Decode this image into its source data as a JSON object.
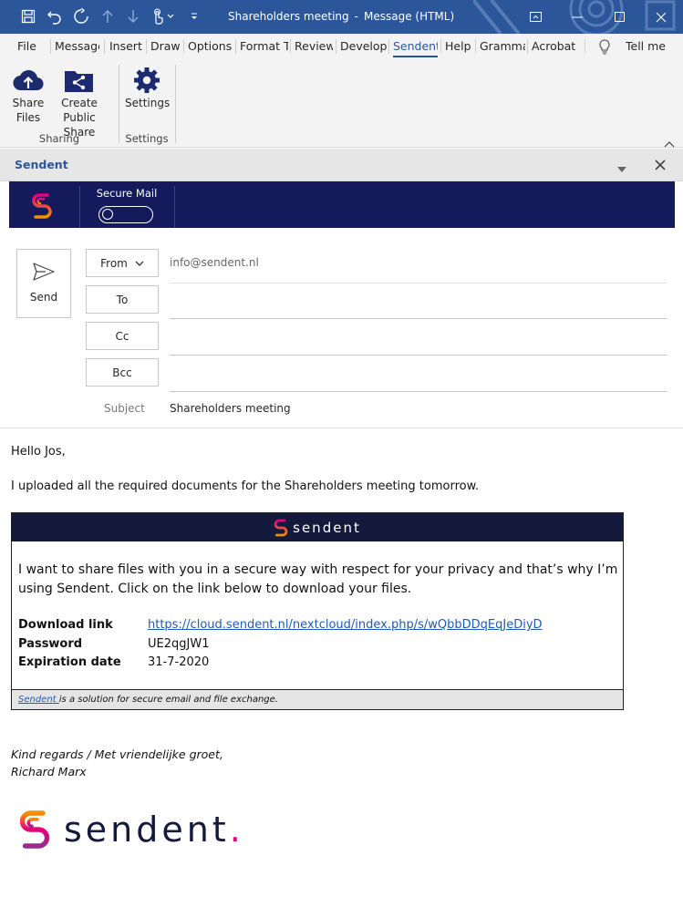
{
  "window": {
    "title": "Shareholders meeting",
    "title_sep": "-",
    "title_suffix": "Message (HTML)"
  },
  "menu": {
    "tabs": [
      "File",
      "Message",
      "Insert",
      "Draw",
      "Options",
      "Format Text",
      "Review",
      "Developer",
      "Sendent",
      "Help",
      "Grammarly",
      "Acrobat"
    ],
    "active": "Sendent",
    "tell_me": "Tell me"
  },
  "ribbon": {
    "share_files": [
      "Share",
      "Files"
    ],
    "create_public_share": [
      "Create",
      "Public Share"
    ],
    "settings": "Settings",
    "group_sharing": "Sharing",
    "group_settings": "Settings"
  },
  "pane": {
    "title": "Sendent",
    "secure_mail_label": "Secure Mail",
    "secure_mail_on": false
  },
  "compose": {
    "send_label": "Send",
    "from_label": "From",
    "from_value": "info@sendent.nl",
    "to_label": "To",
    "cc_label": "Cc",
    "bcc_label": "Bcc",
    "subject_label": "Subject",
    "subject_value": "Shareholders meeting"
  },
  "message": {
    "greeting": "Hello Jos,",
    "intro": "I uploaded all the required documents for the Shareholders meeting tomorrow.",
    "card": {
      "brand": "sendent",
      "text": "I want to share files with you in a secure way with respect for your privacy and that’s why I’m using Sendent. Click on the link below to download your files.",
      "download_label": "Download link",
      "download_url": "https://cloud.sendent.nl/nextcloud/index.php/s/wQbbDDqEqJeDiyD",
      "password_label": "Password",
      "password_value": "UE2qgJW1",
      "expiration_label": "Expiration date",
      "expiration_value": "31-7-2020",
      "footer_link": "Sendent ",
      "footer_text": "is a solution for secure email and file exchange."
    },
    "closing": "Kind regards / Met vriendelijke groet,",
    "name": "Richard Marx",
    "logo_word": "sendent",
    "logo_dot": "."
  },
  "colors": {
    "titlebar": "#2b579a",
    "sendent_navy": "#141a5c",
    "brand_pink": "#e6007e",
    "brand_orange": "#f39200",
    "link": "#1f5bb5"
  }
}
